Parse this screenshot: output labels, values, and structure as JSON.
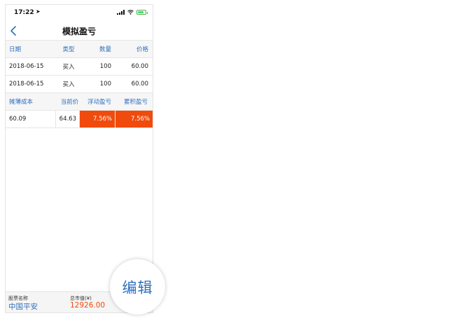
{
  "status_bar": {
    "time": "17:22",
    "location_glyph": "➤",
    "battery_level": 0.8
  },
  "nav": {
    "title": "模拟盈亏",
    "back_icon": "chevron-left-icon"
  },
  "trades_table": {
    "headers": [
      "日期",
      "类型",
      "数量",
      "价格"
    ],
    "rows": [
      [
        "2018-06-15",
        "买入",
        "100",
        "60.00"
      ],
      [
        "2018-06-15",
        "买入",
        "100",
        "60.00"
      ]
    ]
  },
  "summary_table": {
    "headers": [
      "摊薄成本",
      "当前价",
      "浮动盈亏",
      "累积盈亏"
    ],
    "row": [
      "60.09",
      "64.63",
      "7.56%",
      "7.56%"
    ]
  },
  "bottom_bar": {
    "stock_label": "股票名称",
    "stock_value": "中国平安",
    "market_label": "总市值(¥)",
    "market_value": "12926.00"
  },
  "edit_button": {
    "label": "编辑"
  },
  "colors": {
    "accent_blue": "#2f6fbd",
    "profit_orange": "#f04a0c"
  }
}
